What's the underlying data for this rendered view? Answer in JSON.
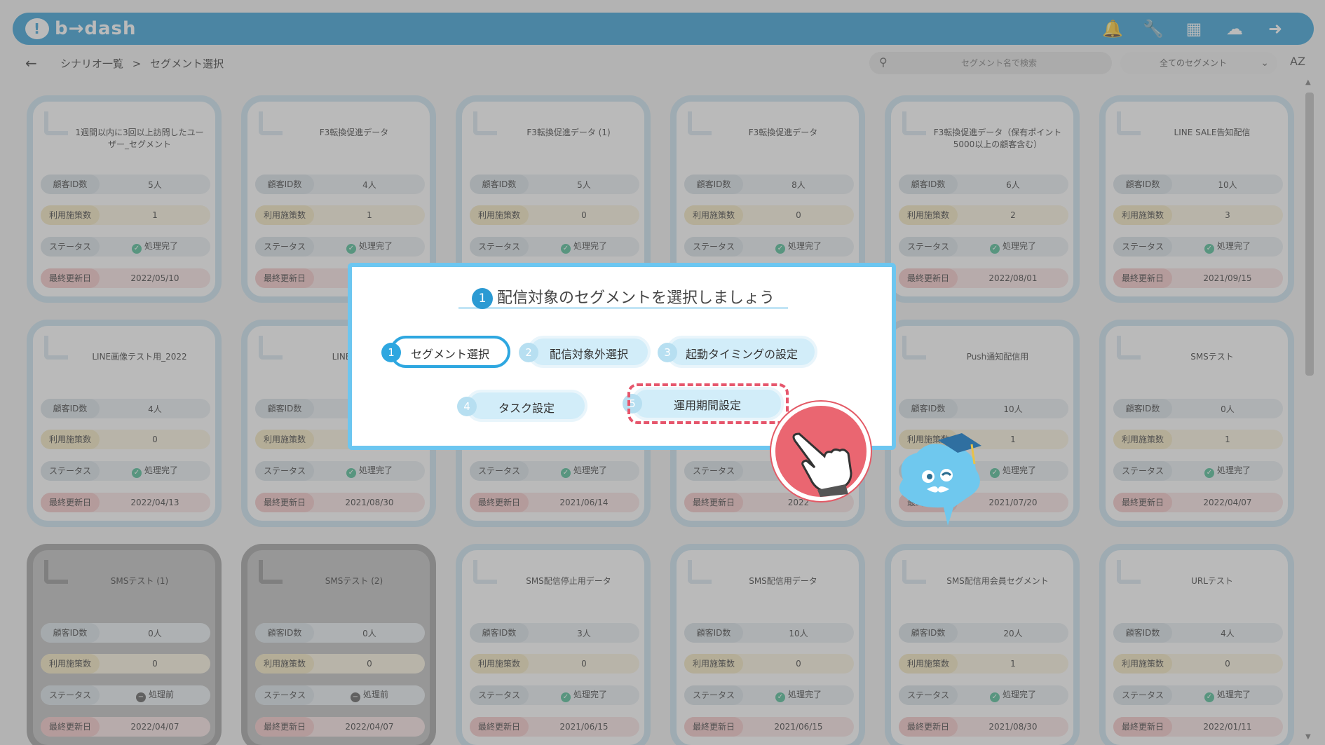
{
  "header": {
    "logo_text": "b→dash",
    "icons": [
      "bell-icon",
      "wrench-icon",
      "grid-icon",
      "chat-icon",
      "logout-icon"
    ]
  },
  "subbar": {
    "breadcrumb_root": "シナリオ一覧",
    "breadcrumb_sep": ">",
    "breadcrumb_current": "セグメント選択",
    "search_placeholder": "セグメント名で検索",
    "filter_value": "全てのセグメント",
    "sort_label": "AZ"
  },
  "labels": {
    "customer_ids": "顧客ID数",
    "used_measures": "利用施策数",
    "status": "ステータス",
    "updated": "最終更新日"
  },
  "cards": [
    {
      "title": "1週間以内に3回以上訪問したユーザー_セグメント",
      "ids": "5人",
      "used": "1",
      "status": "処理完了",
      "date": "2022/05/10",
      "gray": false
    },
    {
      "title": "F3転換促進データ",
      "ids": "4人",
      "used": "1",
      "status": "処理完了",
      "date": "",
      "gray": false
    },
    {
      "title": "F3転換促進データ (1)",
      "ids": "5人",
      "used": "0",
      "status": "処理完了",
      "date": "",
      "gray": false
    },
    {
      "title": "F3転換促進データ",
      "ids": "8人",
      "used": "0",
      "status": "処理完了",
      "date": "",
      "gray": false
    },
    {
      "title": "F3転換促進データ（保有ポイント5000以上の顧客含む）",
      "ids": "6人",
      "used": "2",
      "status": "処理完了",
      "date": "2022/08/01",
      "gray": false
    },
    {
      "title": "LINE SALE告知配信",
      "ids": "10人",
      "used": "3",
      "status": "処理完了",
      "date": "2021/09/15",
      "gray": false
    },
    {
      "title": "LINE画像テスト用_2022",
      "ids": "4人",
      "used": "0",
      "status": "処理完了",
      "date": "2022/04/13",
      "gray": false
    },
    {
      "title": "LINE配信会",
      "ids": "",
      "used": "",
      "status": "処理完了",
      "date": "2021/08/30",
      "gray": false
    },
    {
      "title": "",
      "ids": "",
      "used": "",
      "status": "処理完了",
      "date": "2021/06/14",
      "gray": false
    },
    {
      "title": "",
      "ids": "",
      "used": "",
      "status": "",
      "date": "2022",
      "gray": false
    },
    {
      "title": "Push通知配信用",
      "ids": "10人",
      "used": "1",
      "status": "処理完了",
      "date": "2021/07/20",
      "gray": false
    },
    {
      "title": "SMSテスト",
      "ids": "0人",
      "used": "1",
      "status": "処理完了",
      "date": "2022/04/07",
      "gray": false
    },
    {
      "title": "SMSテスト (1)",
      "ids": "0人",
      "used": "0",
      "status": "処理前",
      "date": "2022/04/07",
      "gray": true
    },
    {
      "title": "SMSテスト (2)",
      "ids": "0人",
      "used": "0",
      "status": "処理前",
      "date": "2022/04/07",
      "gray": true
    },
    {
      "title": "SMS配信停止用データ",
      "ids": "3人",
      "used": "0",
      "status": "処理完了",
      "date": "2021/06/15",
      "gray": false
    },
    {
      "title": "SMS配信用データ",
      "ids": "10人",
      "used": "0",
      "status": "処理完了",
      "date": "2021/06/15",
      "gray": false
    },
    {
      "title": "SMS配信用会員セグメント",
      "ids": "20人",
      "used": "1",
      "status": "処理完了",
      "date": "2021/08/30",
      "gray": false
    },
    {
      "title": "URLテスト",
      "ids": "4人",
      "used": "0",
      "status": "処理完了",
      "date": "2022/01/11",
      "gray": false
    }
  ],
  "modal": {
    "title_num": "1",
    "title": "配信対象のセグメントを選択しましょう",
    "steps": [
      {
        "num": "1",
        "label": "セグメント選択"
      },
      {
        "num": "2",
        "label": "配信対象外選択"
      },
      {
        "num": "3",
        "label": "起動タイミングの設定"
      },
      {
        "num": "4",
        "label": "タスク設定"
      },
      {
        "num": "5",
        "label": "運用期間設定"
      }
    ]
  },
  "colors": {
    "brand": "#2b9ad3",
    "highlight": "#e6566c",
    "status_done": "#43b98f"
  }
}
